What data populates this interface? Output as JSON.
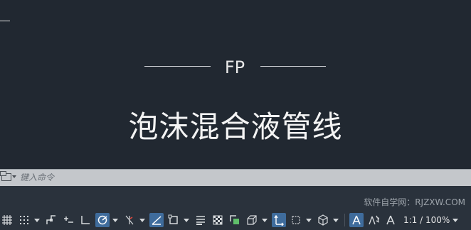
{
  "drawing": {
    "label": "FP",
    "title": "泡沫混合液管线"
  },
  "command_line": {
    "placeholder": "键入命令"
  },
  "watermark": "软件自学网：RJZXW.COM",
  "status_bar": {
    "annotation_scale": "1:1 / 100%",
    "tools": [
      {
        "name": "grid-icon"
      },
      {
        "name": "snap-icon"
      },
      {
        "name": "infer-constraints-icon"
      },
      {
        "name": "dynamic-input-icon"
      },
      {
        "name": "ortho-icon"
      },
      {
        "name": "polar-tracking-icon"
      },
      {
        "name": "isometric-icon"
      },
      {
        "name": "object-snap-tracking-icon"
      },
      {
        "name": "object-snap-icon"
      },
      {
        "name": "lineweight-icon"
      },
      {
        "name": "transparency-icon"
      },
      {
        "name": "selection-cycling-icon"
      },
      {
        "name": "3d-osnap-icon"
      },
      {
        "name": "ucs-icon"
      },
      {
        "name": "gizmo-icon"
      },
      {
        "name": "annotation-visibility-icon"
      },
      {
        "name": "auto-scale-icon"
      },
      {
        "name": "annotation-scale-icon"
      }
    ]
  },
  "colors": {
    "canvas": "#212831",
    "command_bar": "#c4c7cb",
    "status_bar": "#2a323c",
    "active_tool": "#3f6c9c"
  }
}
